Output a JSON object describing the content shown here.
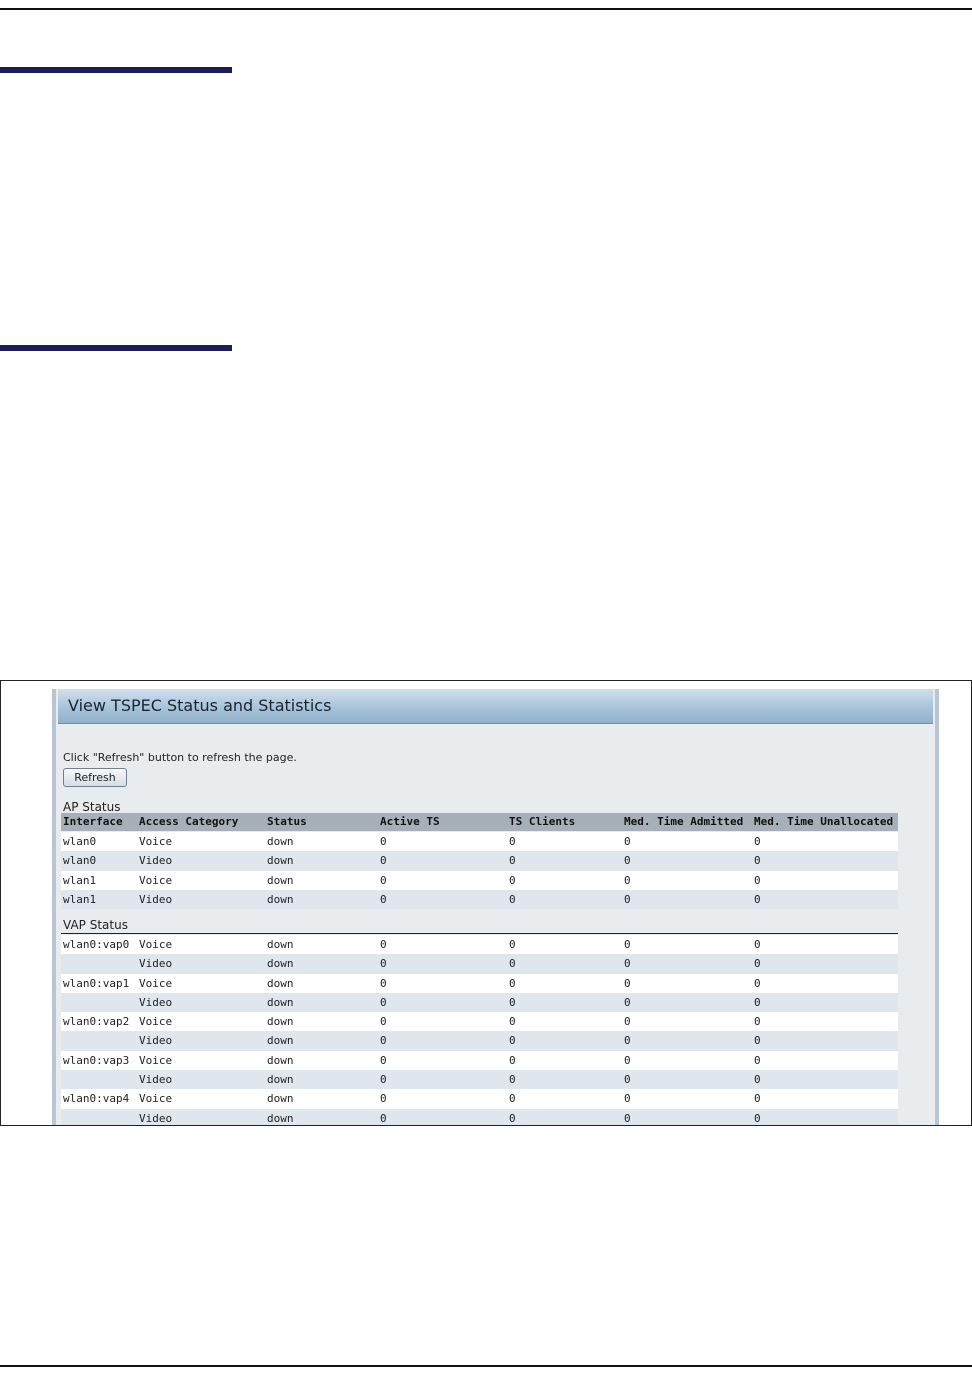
{
  "panel": {
    "title": "View TSPEC Status and Statistics",
    "instruction": "Click \"Refresh\" button to refresh the page.",
    "refresh_label": "Refresh"
  },
  "ap_status": {
    "label": "AP Status",
    "headers": [
      "Interface",
      "Access Category",
      "Status",
      "Active TS",
      "TS Clients",
      "Med. Time Admitted",
      "Med. Time Unallocated"
    ],
    "rows": [
      [
        "wlan0",
        "Voice",
        "down",
        "0",
        "0",
        "0",
        "0"
      ],
      [
        "wlan0",
        "Video",
        "down",
        "0",
        "0",
        "0",
        "0"
      ],
      [
        "wlan1",
        "Voice",
        "down",
        "0",
        "0",
        "0",
        "0"
      ],
      [
        "wlan1",
        "Video",
        "down",
        "0",
        "0",
        "0",
        "0"
      ]
    ]
  },
  "vap_status": {
    "label": "VAP Status",
    "rows": [
      [
        "wlan0:vap0",
        "Voice",
        "down",
        "0",
        "0",
        "0",
        "0"
      ],
      [
        "",
        "Video",
        "down",
        "0",
        "0",
        "0",
        "0"
      ],
      [
        "wlan0:vap1",
        "Voice",
        "down",
        "0",
        "0",
        "0",
        "0"
      ],
      [
        "",
        "Video",
        "down",
        "0",
        "0",
        "0",
        "0"
      ],
      [
        "wlan0:vap2",
        "Voice",
        "down",
        "0",
        "0",
        "0",
        "0"
      ],
      [
        "",
        "Video",
        "down",
        "0",
        "0",
        "0",
        "0"
      ],
      [
        "wlan0:vap3",
        "Voice",
        "down",
        "0",
        "0",
        "0",
        "0"
      ],
      [
        "",
        "Video",
        "down",
        "0",
        "0",
        "0",
        "0"
      ],
      [
        "wlan0:vap4",
        "Voice",
        "down",
        "0",
        "0",
        "0",
        "0"
      ],
      [
        "",
        "Video",
        "down",
        "0",
        "0",
        "0",
        "0"
      ]
    ]
  }
}
